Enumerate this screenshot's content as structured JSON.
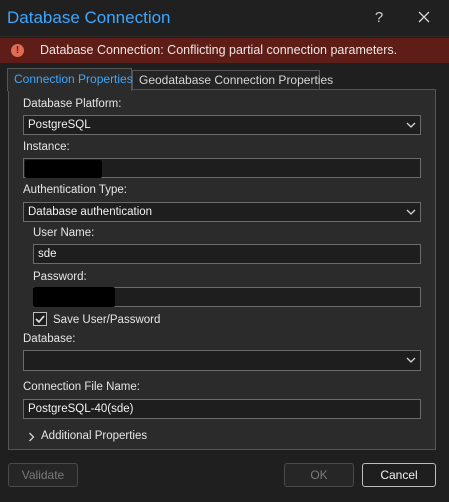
{
  "window": {
    "title": "Database Connection",
    "help_label": "?",
    "accent_color": "#3ea6ff"
  },
  "error": {
    "message": "Database Connection: Conflicting partial connection parameters.",
    "icon": "error-icon",
    "color": "#5e1d17"
  },
  "tabs": [
    {
      "label": "Connection Properties",
      "active": true
    },
    {
      "label": "Geodatabase Connection Properties",
      "active": false
    }
  ],
  "form": {
    "platform_label": "Database Platform:",
    "platform_value": "PostgreSQL",
    "instance_label": "Instance:",
    "instance_value": "",
    "auth_label": "Authentication Type:",
    "auth_value": "Database authentication",
    "username_label": "User Name:",
    "username_value": "sde",
    "password_label": "Password:",
    "password_value": "",
    "save_label": "Save User/Password",
    "save_checked": true,
    "database_label": "Database:",
    "database_value": "",
    "filename_label": "Connection File Name:",
    "filename_value": "PostgreSQL-40(sde)",
    "additional_label": "Additional Properties"
  },
  "buttons": {
    "validate": "Validate",
    "ok": "OK",
    "cancel": "Cancel"
  }
}
